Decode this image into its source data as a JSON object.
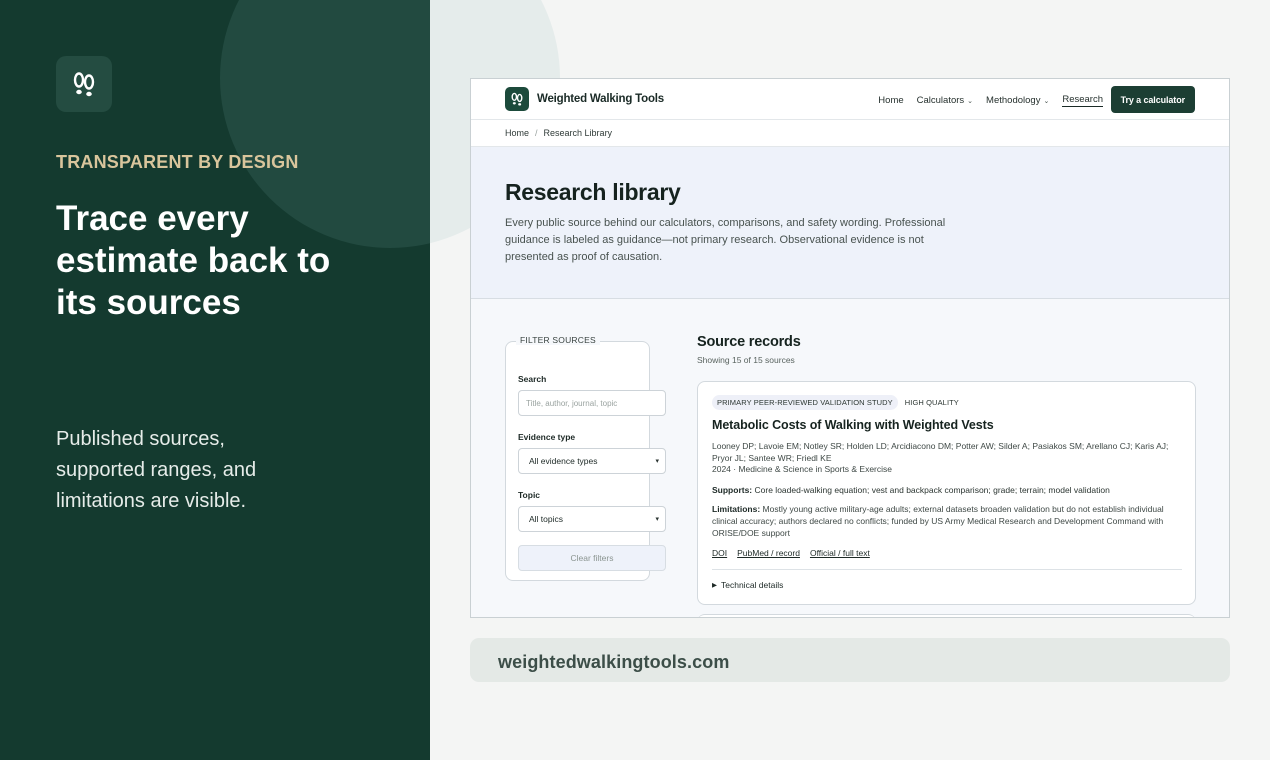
{
  "promo": {
    "logo_icon": "footprints-icon",
    "kicker": "TRANSPARENT BY DESIGN",
    "headline": "Trace every estimate back to its sources",
    "subline": "Published sources, supported ranges, and limitations are visible.",
    "colors": {
      "panel": "#143a2f",
      "kicker": "#d9c59c"
    }
  },
  "site": {
    "brand": "Weighted Walking Tools",
    "nav": [
      {
        "label": "Home"
      },
      {
        "label": "Calculators",
        "chevron": "⌄"
      },
      {
        "label": "Methodology",
        "chevron": "⌄"
      },
      {
        "label": "Research",
        "active": true
      }
    ],
    "cta": "Try a calculator",
    "breadcrumb": {
      "home": "Home",
      "sep": "/",
      "current": "Research Library"
    }
  },
  "hero": {
    "title": "Research library",
    "description": "Every public source behind our calculators, comparisons, and safety wording. Professional guidance is labeled as guidance—not primary research. Observational evidence is not presented as proof of causation."
  },
  "filters": {
    "legend": "FILTER SOURCES",
    "search_label": "Search",
    "search_placeholder": "Title, author, journal, topic",
    "evidence_label": "Evidence type",
    "evidence_value": "All evidence types",
    "topic_label": "Topic",
    "topic_value": "All topics",
    "clear": "Clear filters"
  },
  "records": {
    "title": "Source records",
    "count": "Showing 15 of 15 sources",
    "items": [
      {
        "badge_type": "PRIMARY PEER-REVIEWED VALIDATION STUDY",
        "badge_quality": "HIGH QUALITY",
        "title": "Metabolic Costs of Walking with Weighted Vests",
        "authors": "Looney DP; Lavoie EM; Notley SR; Holden LD; Arcidiacono DM; Potter AW; Silder A; Pasiakos SM; Arellano CJ; Karis AJ; Pryor JL; Santee WR; Friedl KE",
        "publication": "2024 · Medicine & Science in Sports & Exercise",
        "supports_label": "Supports:",
        "supports": "Core loaded-walking equation; vest and backpack comparison; grade; terrain; model validation",
        "limitations_label": "Limitations:",
        "limitations": "Mostly young active military-age adults; external datasets broaden validation but do not establish individual clinical accuracy; authors declared no conflicts; funded by US Army Medical Research and Development Command with ORISE/DOE support",
        "links": [
          "DOI",
          "PubMed / record",
          "Official / full text"
        ],
        "details": "Technical details"
      }
    ]
  },
  "url": "weightedwalkingtools.com"
}
